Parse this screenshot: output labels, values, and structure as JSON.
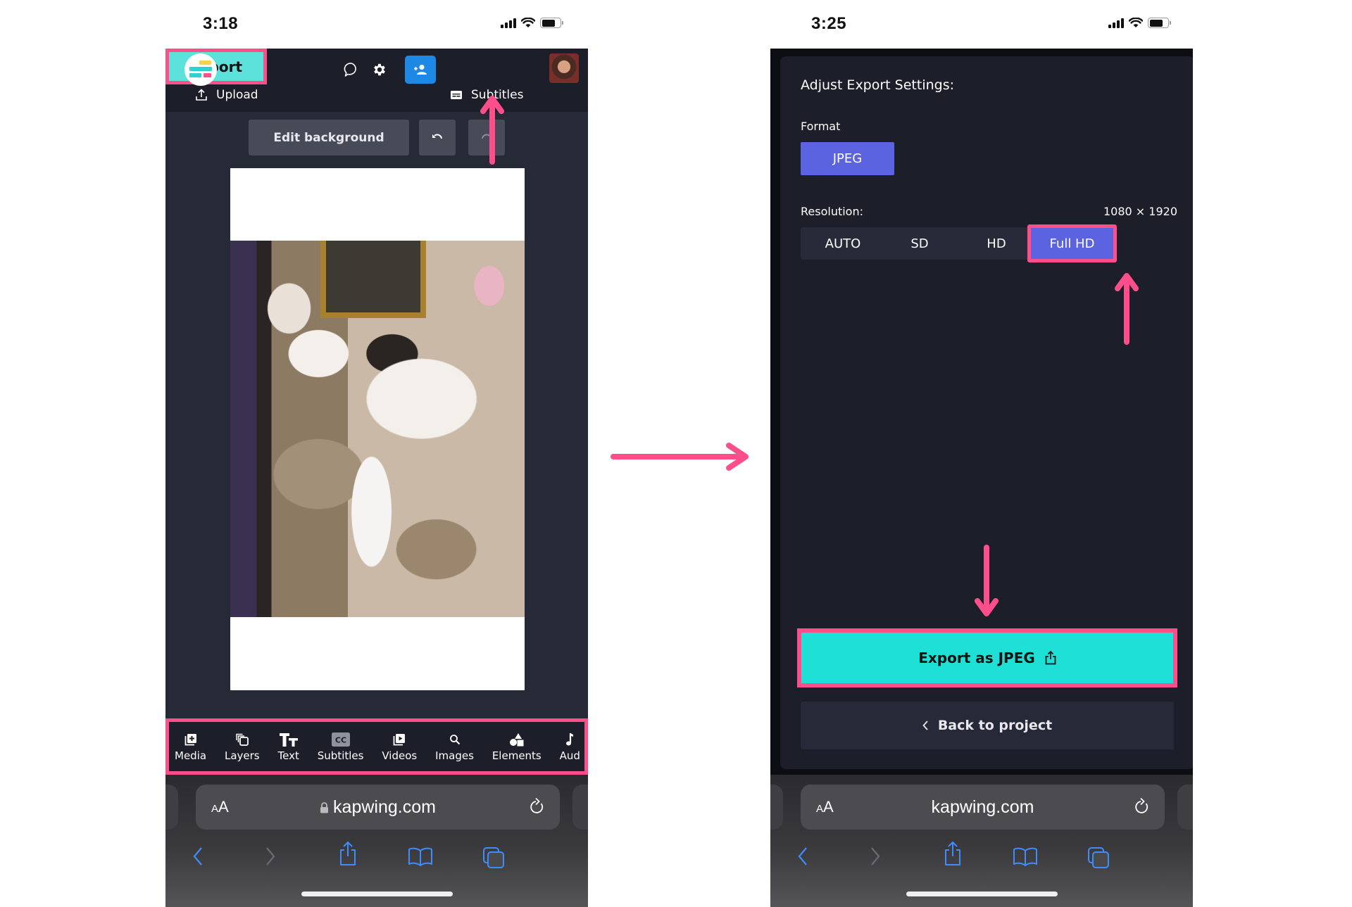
{
  "left_phone": {
    "status": {
      "time": "3:18"
    },
    "header": {
      "logo": "kapwing-logo",
      "icons": [
        "comment-icon",
        "gear-icon",
        "add-user-icon"
      ],
      "export_label": "Export",
      "avatar": "user-avatar"
    },
    "subnav": {
      "upload_label": "Upload",
      "subtitles_label": "Subtitles"
    },
    "canvas_toolbar": {
      "edit_background_label": "Edit background",
      "undo": "undo-icon",
      "redo": "redo-icon"
    },
    "canvas": {
      "content": "calico cat photo on white background"
    },
    "tools": [
      {
        "label": "Media",
        "icon": "media-add-icon"
      },
      {
        "label": "Layers",
        "icon": "layers-icon"
      },
      {
        "label": "Text",
        "icon": "text-icon"
      },
      {
        "label": "Subtitles",
        "icon": "cc-icon"
      },
      {
        "label": "Videos",
        "icon": "video-icon"
      },
      {
        "label": "Images",
        "icon": "search-icon"
      },
      {
        "label": "Elements",
        "icon": "shapes-icon"
      },
      {
        "label": "Aud",
        "icon": "music-icon"
      }
    ],
    "safari": {
      "text_size": "AA",
      "url": "kapwing.com",
      "secure": true
    }
  },
  "right_phone": {
    "status": {
      "time": "3:25"
    },
    "modal": {
      "title": "Adjust Export Settings:",
      "format_label": "Format",
      "format_value": "JPEG",
      "resolution_label": "Resolution:",
      "resolution_value": "1080 × 1920",
      "resolution_options": [
        "AUTO",
        "SD",
        "HD",
        "Full HD"
      ],
      "resolution_selected": "Full HD",
      "export_button_label": "Export as JPEG",
      "back_button_label": "Back to project"
    },
    "safari": {
      "text_size": "AA",
      "url": "kapwing.com",
      "secure": false
    }
  },
  "colors": {
    "annotation_pink": "#ff4f8b",
    "export_teal": "#5ce1db",
    "export_jpeg_teal": "#1ee0d6",
    "selected_purple": "#5b63e0",
    "app_dark": "#1c1e2a",
    "safari_blue": "#3f8cff"
  }
}
